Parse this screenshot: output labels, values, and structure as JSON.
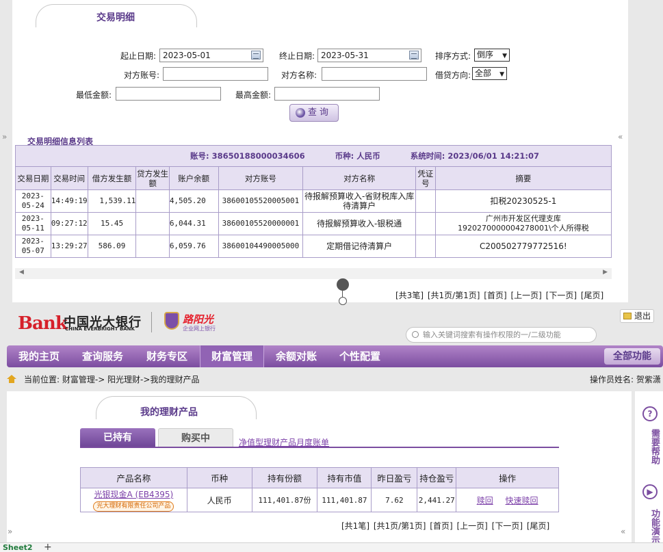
{
  "detail": {
    "tab_title": "交易明细",
    "start_label": "起止日期:",
    "start_value": "2023-05-01",
    "end_label": "终止日期:",
    "end_value": "2023-05-31",
    "sort_label": "排序方式:",
    "sort_value": "倒序",
    "counter_acct_label": "对方账号:",
    "counter_name_label": "对方名称:",
    "direction_label": "借贷方向:",
    "direction_value": "全部",
    "min_label": "最低金额:",
    "max_label": "最高金额:",
    "query_label": "查询",
    "list_title": "交易明细信息列表",
    "account_line": {
      "account": "账号: 38650188000034606",
      "currency": "币种: 人民币",
      "systime": "系统时间: 2023/06/01 14:21:07"
    },
    "columns": [
      "交易日期",
      "交易时间",
      "借方发生额",
      "贷方发生额",
      "账户余额",
      "对方账号",
      "对方名称",
      "凭证号",
      "摘要"
    ],
    "rows": [
      {
        "date": "2023-05-24",
        "time": "14:49:19",
        "debit": "1,539.11",
        "credit": "",
        "balance": "4,505.20",
        "acct": "38600105520005001",
        "name": "待报解预算收入-省财税库入库待清算户",
        "voucher": "",
        "memo": "扣税20230525-1"
      },
      {
        "date": "2023-05-11",
        "time": "09:27:12",
        "debit": "15.45",
        "credit": "",
        "balance": "6,044.31",
        "acct": "38600105520000001",
        "name": "待报解预算收入-银税通",
        "voucher": "",
        "memo": "广州市开发区代理支库1920270000004278001\\个人所得税"
      },
      {
        "date": "2023-05-07",
        "time": "13:29:27",
        "debit": "586.09",
        "credit": "",
        "balance": "6,059.76",
        "acct": "38600104490005000",
        "name": "定期借记待清算户",
        "voucher": "",
        "memo": "C200502779772516!"
      }
    ],
    "pager": "[共3笔] [共1页/第1页] [首页] [上一页] [下一页] [尾页]"
  },
  "bank": {
    "logo_prefix": "Bank",
    "logo_cn": "中国光大银行",
    "logo_en": "CHINA EVERBRIGHT BANK",
    "sub_brand": "路阳光",
    "sub_brand_caption": "企业网上银行",
    "logout": "退出",
    "search_placeholder": "输入关键词搜索有操作权限的一/二级功能",
    "nav": [
      "我的主页",
      "查询服务",
      "财务专区",
      "财富管理",
      "余额对账",
      "个性配置"
    ],
    "nav_active": "财富管理",
    "all_functions": "全部功能",
    "breadcrumb": "当前位置: 财富管理-> 阳光理财->我的理财产品",
    "operator": "操作员姓名: 贺紫潇"
  },
  "wealth": {
    "tab_title": "我的理财产品",
    "tab_held": "已持有",
    "tab_buying": "购买中",
    "monthly_link": "净值型理财产品月度账单",
    "columns": [
      "产品名称",
      "币种",
      "持有份额",
      "持有市值",
      "昨日盈亏",
      "持仓盈亏",
      "操作"
    ],
    "rows": [
      {
        "product": "光银现金A (EB4395)",
        "issuer": "光大理财有限责任公司产品",
        "currency": "人民币",
        "shares": "111,401.87份",
        "market_value": "111,401.87",
        "yesterday": "7.62",
        "total": "2,441.27",
        "redeem": "赎回",
        "fast_redeem": "快速赎回"
      }
    ],
    "pager": "[共1笔] [共1页/第1页] [首页] [上一页] [下一页] [尾页]",
    "help": "需要帮助",
    "demo": "功能演示"
  },
  "sheet": {
    "name": "Sheet2",
    "add": "+"
  },
  "colors": {
    "brand_purple": "#7b4da0",
    "header_bg": "#e6e0f2",
    "logo_red": "#d6202a"
  }
}
